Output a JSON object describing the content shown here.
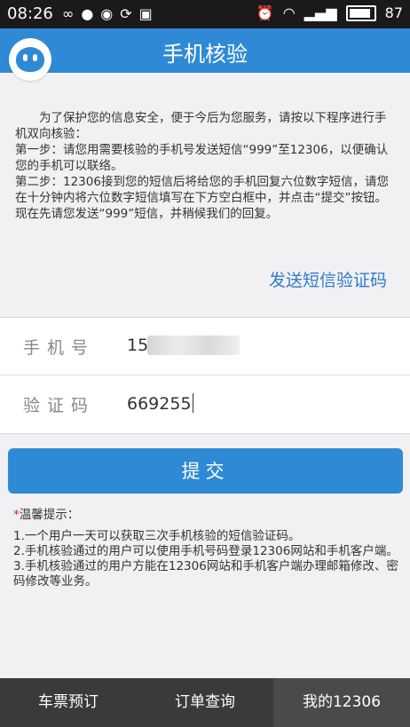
{
  "status_bar": {
    "time": "08:26",
    "battery": "87"
  },
  "header": {
    "title": "手机核验"
  },
  "intro": {
    "paragraph1": "为了保护您的信息安全，便于今后为您服务，请按以下程序进行手机双向核验：",
    "step1": "第一步：请您用需要核验的手机号发送短信“999”至12306，以便确认您的手机可以联络。",
    "step2": "第二步：12306接到您的短信后将给您的手机回复六位数字短信，请您在十分钟内将六位数字短信填写在下方空白框中，并点击“提交”按钮。 现在先请您发送“999”短信，并稍候我们的回复。"
  },
  "send_sms_link": "发送短信验证码",
  "form": {
    "phone_label": "手机号",
    "phone_value": "15",
    "code_label": "验证码",
    "code_value": "669255"
  },
  "submit_label": "提交",
  "tips": {
    "star": "*",
    "title": "温馨提示：",
    "items": [
      "1.一个用户一天可以获取三次手机核验的短信验证码。",
      "2.手机核验通过的用户可以使用手机号码登录12306网站和手机客户端。",
      "3.手机核验通过的用户方能在12306网站和手机客户端办理邮箱修改、密码修改等业务。"
    ]
  },
  "tabbar": {
    "tabs": [
      "车票预订",
      "订单查询",
      "我的12306"
    ]
  }
}
